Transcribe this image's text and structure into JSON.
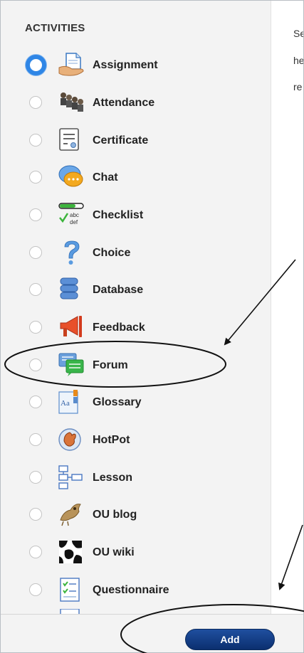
{
  "section_heading": "ACTIVITIES",
  "intro_lines": [
    "Se",
    "he",
    "re"
  ],
  "activities": [
    {
      "label": "Assignment",
      "icon": "assignment-icon",
      "selected": true
    },
    {
      "label": "Attendance",
      "icon": "attendance-icon",
      "selected": false
    },
    {
      "label": "Certificate",
      "icon": "certificate-icon",
      "selected": false
    },
    {
      "label": "Chat",
      "icon": "chat-icon",
      "selected": false
    },
    {
      "label": "Checklist",
      "icon": "checklist-icon",
      "selected": false
    },
    {
      "label": "Choice",
      "icon": "choice-icon",
      "selected": false
    },
    {
      "label": "Database",
      "icon": "database-icon",
      "selected": false
    },
    {
      "label": "Feedback",
      "icon": "feedback-icon",
      "selected": false
    },
    {
      "label": "Forum",
      "icon": "forum-icon",
      "selected": false
    },
    {
      "label": "Glossary",
      "icon": "glossary-icon",
      "selected": false
    },
    {
      "label": "HotPot",
      "icon": "hotpot-icon",
      "selected": false
    },
    {
      "label": "Lesson",
      "icon": "lesson-icon",
      "selected": false
    },
    {
      "label": "OU blog",
      "icon": "ou-blog-icon",
      "selected": false
    },
    {
      "label": "OU wiki",
      "icon": "ou-wiki-icon",
      "selected": false
    },
    {
      "label": "Questionnaire",
      "icon": "questionnaire-icon",
      "selected": false
    }
  ],
  "footer": {
    "add_label": "Add"
  },
  "colors": {
    "accent": "#2f86e6",
    "button": "#0b2f6f",
    "pane_background": "#f3f3f3"
  }
}
